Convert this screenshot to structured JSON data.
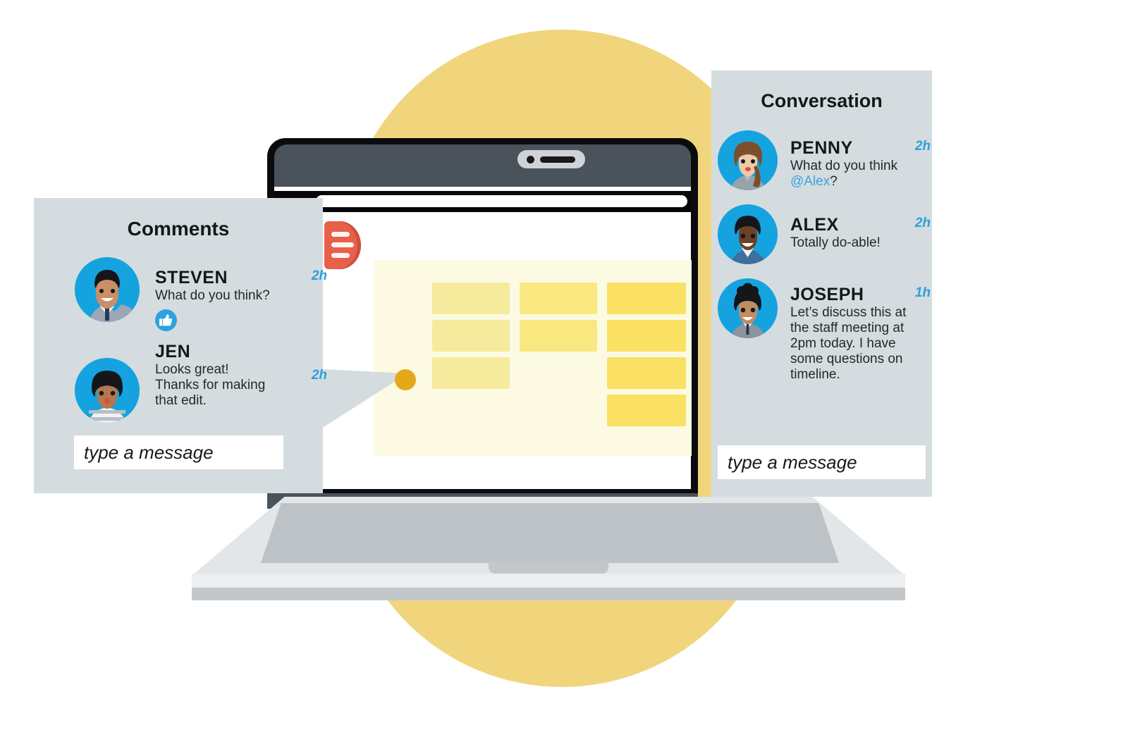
{
  "scene": {
    "title": "Collaboration illustration",
    "background_circle_color": "#f0d57d",
    "device": "laptop"
  },
  "device": {
    "name": "laptop",
    "bezel_color": "#4a525c",
    "frame_color": "#0b0b0d",
    "base_color": "#e2e6e9",
    "webcam_label": "webcam",
    "url_bar_value": ""
  },
  "document": {
    "name": "spreadsheet-document",
    "background_color": "#fcfae2",
    "marker_color": "#e8604a",
    "pin_color": "#e5a818",
    "blocks": [
      {
        "col": 1,
        "row": 1,
        "color": "#f6eb9c"
      },
      {
        "col": 1,
        "row": 2,
        "color": "#f6eb9c"
      },
      {
        "col": 1,
        "row": 3,
        "color": "#f6eb9c"
      },
      {
        "col": 2,
        "row": 1,
        "color": "#f8e87f"
      },
      {
        "col": 2,
        "row": 2,
        "color": "#f8e87f"
      },
      {
        "col": 3,
        "row": 1,
        "color": "#fae063"
      },
      {
        "col": 3,
        "row": 2,
        "color": "#fae063"
      },
      {
        "col": 3,
        "row": 3,
        "color": "#fae063"
      },
      {
        "col": 3,
        "row": 4,
        "color": "#fae063"
      }
    ]
  },
  "comments_panel": {
    "title": "Comments",
    "background_color": "#d5dcdf",
    "messages": [
      {
        "name": "STEVEN",
        "time": "2h",
        "text": "What do you think?",
        "avatar": "avatar-steven",
        "reaction": "thumbs-up-icon"
      },
      {
        "name": "JEN",
        "time": "2h",
        "text": "Looks great! Thanks for making that edit.",
        "avatar": "avatar-jen",
        "reaction": null
      }
    ],
    "input": {
      "placeholder": "type a message",
      "value": ""
    }
  },
  "conversation_panel": {
    "title": "Conversation",
    "background_color": "#d5dcdf",
    "messages": [
      {
        "name": "PENNY",
        "time": "2h",
        "text_before": "What do you think ",
        "mention": "@Alex",
        "text_after": "?",
        "avatar": "avatar-penny"
      },
      {
        "name": "ALEX",
        "time": "2h",
        "text_before": "Totally do-able!",
        "mention": "",
        "text_after": "",
        "avatar": "avatar-alex"
      },
      {
        "name": "JOSEPH",
        "time": "1h",
        "text_before": "Let’s discuss this at the staff meeting at 2pm today. I have some questions on timeline.",
        "mention": "",
        "text_after": "",
        "avatar": "avatar-joseph"
      }
    ],
    "input": {
      "placeholder": "type a message",
      "value": ""
    }
  },
  "colors": {
    "accent_blue": "#2ba0dd",
    "avatar_bg": "#15a3e0",
    "panel_bg": "#d5dcdf",
    "yellow": "#f0d57d"
  }
}
